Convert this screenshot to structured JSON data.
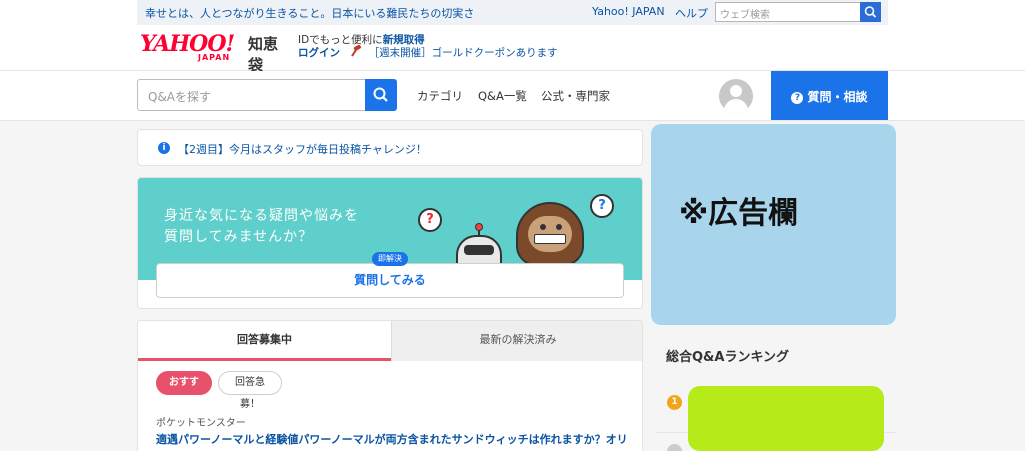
{
  "topbar": {
    "headline": "幸せとは、人とつながり生きること。日本にいる難民たちの切実さ",
    "yahoo_japan": "Yahoo! JAPAN",
    "help": "ヘルプ",
    "web_search_placeholder": "ウェブ検索"
  },
  "header": {
    "logo_yahoo": "YAHOO!",
    "logo_japan": "JAPAN",
    "logo_service": "知恵袋",
    "promo_prefix": "IDでもっと便利に",
    "promo_link": "新規取得",
    "login": "ログイン",
    "coupon": "［週末開催］ゴールドクーポンあります"
  },
  "nav": {
    "search_placeholder": "Q&Aを探す",
    "links": [
      "カテゴリ",
      "Q&A一覧",
      "公式・専門家"
    ],
    "ask_button": "質問・相談"
  },
  "notice": {
    "text": "【2週目】今月はスタッフが毎日投稿チャレンジ！"
  },
  "banner": {
    "line1": "身近な気になる疑問や悩みを",
    "line2": "質問してみませんか？",
    "tag": "即解決",
    "cta": "質問してみる"
  },
  "tabs": {
    "active": "回答募集中",
    "inactive": "最新の解決済み"
  },
  "filters": {
    "recommended": "おすすめ",
    "urgent": "回答急募！"
  },
  "question": {
    "category": "ポケットモンスター",
    "title": "適遇パワーノーマルと経験値パワーノーマルが両方含まれたサンドウィッチは作れますか？オリ…"
  },
  "sidebar": {
    "ad_label": "※広告欄",
    "ranking_title": "総合Q&Aランキング",
    "rank1": "1"
  },
  "colors": {
    "brand_red": "#ff0033",
    "accent_blue": "#1a73e8",
    "teal": "#5ecfca",
    "tab_underline": "#e8516b"
  }
}
